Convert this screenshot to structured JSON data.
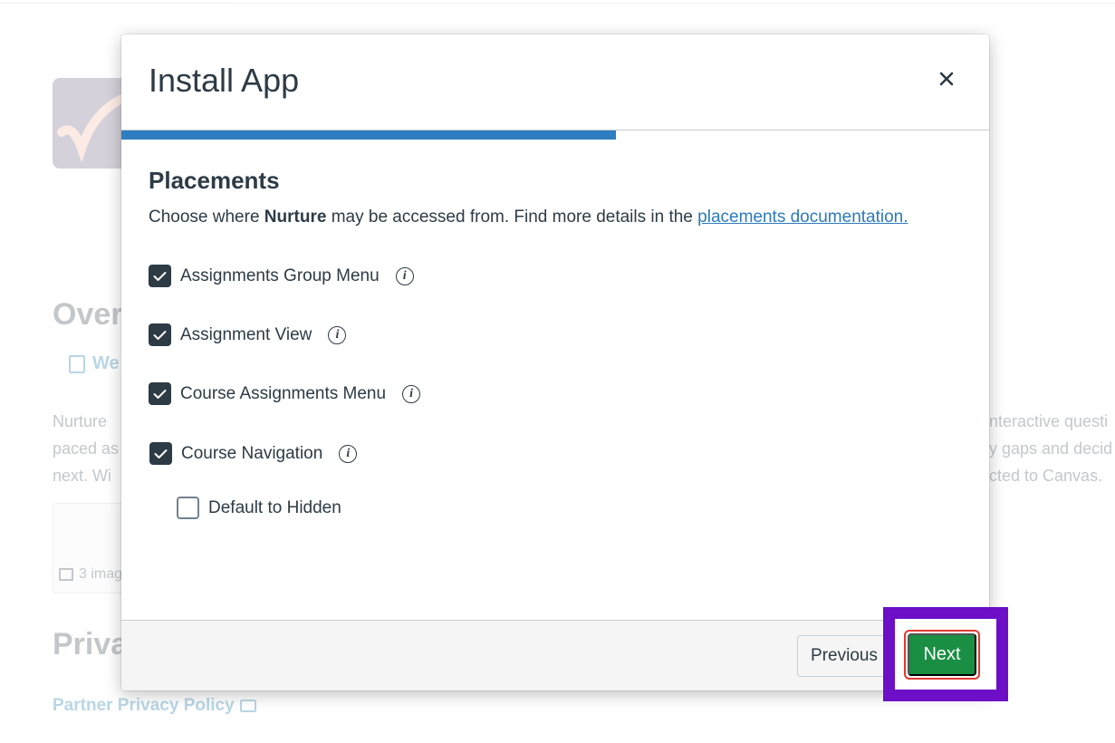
{
  "background": {
    "overview_heading": "Over",
    "web_link": "We",
    "description_lines_left": [
      "Nurture",
      "paced as",
      "next. Wi"
    ],
    "description_lines_right": [
      "nteractive questi",
      "y gaps and decid",
      "cted to Canvas."
    ],
    "images_caption": "3 imag",
    "privacy_heading": "Priva",
    "privacy_link": "Partner Privacy Policy"
  },
  "modal": {
    "title": "Install App",
    "close_label": "×",
    "progress_fraction": 0.57,
    "section_title": "Placements",
    "description": {
      "prefix": "Choose where ",
      "app_name": "Nurture",
      "middle": " may be accessed from. Find more details in the ",
      "link": "placements documentation."
    },
    "placements": [
      {
        "label": "Assignments Group Menu",
        "checked": true
      },
      {
        "label": "Assignment View",
        "checked": true
      },
      {
        "label": "Course Assignments Menu",
        "checked": true
      },
      {
        "label": "Course Navigation",
        "checked": true
      }
    ],
    "sub_option": {
      "label": "Default to Hidden",
      "checked": false
    },
    "info_icon": "info-icon",
    "footer": {
      "previous_label": "Previous",
      "next_label": "Next"
    }
  },
  "colors": {
    "progress": "#2d7dc0",
    "next_button": "#1a8f44",
    "highlight": "#6c0fc6",
    "focus_ring": "#e13a30",
    "checkbox": "#2d3b45"
  }
}
